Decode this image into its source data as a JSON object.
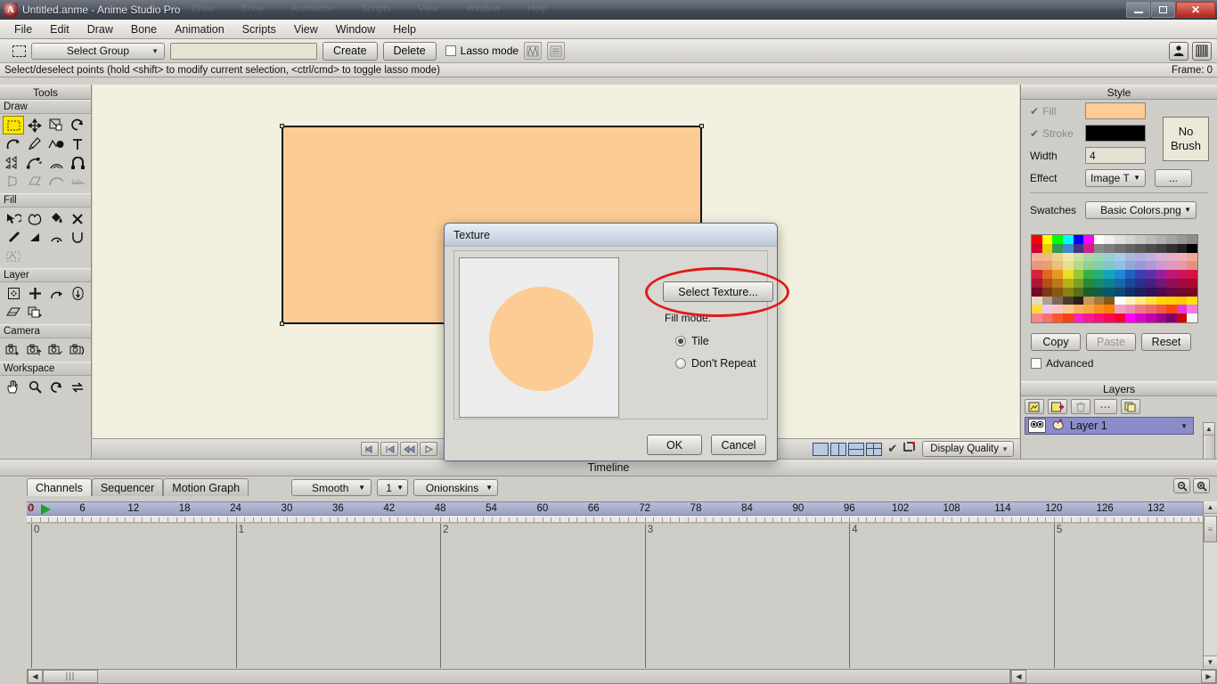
{
  "window": {
    "title": "Untitled.anme - Anime Studio Pro",
    "app_icon": "anime-studio-icon",
    "minimize": "minimize-icon",
    "restore": "restore-icon",
    "close": "close-icon",
    "ghost_menu": [
      "Draw",
      "Bone",
      "Animation",
      "Scripts",
      "View",
      "Window",
      "Help"
    ]
  },
  "menubar": {
    "items": [
      "File",
      "Edit",
      "Draw",
      "Bone",
      "Animation",
      "Scripts",
      "View",
      "Window",
      "Help"
    ]
  },
  "toolbar": {
    "marquee_icon": "marquee-select-icon",
    "group_dropdown": "Select Group",
    "name_field_value": "",
    "create_label": "Create",
    "delete_label": "Delete",
    "lasso_label": "Lasso mode",
    "lasso_checked": false,
    "icon1": "symmetry-icon",
    "icon2": "point-list-icon",
    "right_icon1": "character-icon",
    "right_icon2": "library-icon"
  },
  "statusline": {
    "hint": "Select/deselect points (hold <shift> to modify current selection, <ctrl/cmd> to toggle lasso mode)",
    "frame": "Frame: 0"
  },
  "tools_panel": {
    "title": "Tools",
    "sections": [
      {
        "name": "Draw",
        "tools": [
          {
            "name": "select-points-tool",
            "icon": "marquee-icon",
            "selected": true,
            "dim": false
          },
          {
            "name": "transform-points-tool",
            "icon": "move-arrows-icon",
            "selected": false,
            "dim": false
          },
          {
            "name": "scale-points-tool",
            "icon": "scale-icon",
            "selected": false,
            "dim": false
          },
          {
            "name": "rotate-points-tool",
            "icon": "rotate-icon",
            "selected": false,
            "dim": false
          },
          {
            "name": "curvature-tool",
            "icon": "curve-icon",
            "selected": false,
            "dim": false
          },
          {
            "name": "add-point-tool",
            "icon": "pen-icon",
            "selected": false,
            "dim": false
          },
          {
            "name": "draw-shape-tool",
            "icon": "shape-icon",
            "selected": false,
            "dim": false
          },
          {
            "name": "text-tool",
            "icon": "text-icon",
            "selected": false,
            "dim": false
          },
          {
            "name": "magnet-tool",
            "icon": "triangles-icon",
            "selected": false,
            "dim": false
          },
          {
            "name": "perspective-points-tool",
            "icon": "perspective-icon",
            "selected": false,
            "dim": false
          },
          {
            "name": "bend-points-tool",
            "icon": "bend-icon",
            "selected": false,
            "dim": false
          },
          {
            "name": "noise-tool",
            "icon": "magnet-icon",
            "selected": false,
            "dim": false
          },
          {
            "name": "shear-points-tool",
            "icon": "shear-icon",
            "selected": false,
            "dim": true
          },
          {
            "name": "weld-points-tool",
            "icon": "weld-icon",
            "selected": false,
            "dim": true
          },
          {
            "name": "smooth-tool",
            "icon": "smooth-arc-icon",
            "selected": false,
            "dim": true
          },
          {
            "name": "hatch-tool",
            "icon": "hatch-icon",
            "selected": false,
            "dim": true
          }
        ]
      },
      {
        "name": "Fill",
        "tools": [
          {
            "name": "select-shape-tool",
            "icon": "cursor-shape-icon",
            "selected": false,
            "dim": false
          },
          {
            "name": "create-shape-tool",
            "icon": "blob-icon",
            "selected": false,
            "dim": false
          },
          {
            "name": "paint-bucket-tool",
            "icon": "paint-bucket-icon",
            "selected": false,
            "dim": false
          },
          {
            "name": "delete-shape-tool",
            "icon": "x-icon",
            "selected": false,
            "dim": false
          },
          {
            "name": "eyedropper-tool",
            "icon": "eyedropper-icon",
            "selected": false,
            "dim": false
          },
          {
            "name": "gradient-tool",
            "icon": "gradient-triangle-icon",
            "selected": false,
            "dim": false
          },
          {
            "name": "line-width-tool",
            "icon": "line-width-icon",
            "selected": false,
            "dim": false
          },
          {
            "name": "hide-edge-tool",
            "icon": "hide-edge-icon",
            "selected": false,
            "dim": false
          },
          {
            "name": "stroke-exposure-tool",
            "icon": "stroke-exposure-icon",
            "selected": false,
            "dim": true
          }
        ]
      },
      {
        "name": "Layer",
        "tools": [
          {
            "name": "transform-layer-tool",
            "icon": "transform-layer-icon",
            "selected": false,
            "dim": false
          },
          {
            "name": "translate-layer-tool",
            "icon": "plus-move-icon",
            "selected": false,
            "dim": false
          },
          {
            "name": "rotate-layer-z-tool",
            "icon": "rotate-z-icon",
            "selected": false,
            "dim": false
          },
          {
            "name": "rotate-layer-xy-tool",
            "icon": "rotate-xy-icon",
            "selected": false,
            "dim": false
          },
          {
            "name": "shear-layer-tool",
            "icon": "shear-layer-icon",
            "selected": false,
            "dim": false
          },
          {
            "name": "set-origin-tool",
            "icon": "layer-order-icon",
            "selected": false,
            "dim": false
          }
        ]
      },
      {
        "name": "Camera",
        "tools": [
          {
            "name": "track-camera-tool",
            "icon": "camera-track-icon",
            "selected": false,
            "dim": false
          },
          {
            "name": "zoom-camera-tool",
            "icon": "camera-zoom-icon",
            "selected": false,
            "dim": false
          },
          {
            "name": "roll-camera-tool",
            "icon": "camera-roll-icon",
            "selected": false,
            "dim": false
          },
          {
            "name": "pan-tilt-camera-tool",
            "icon": "camera-pan-icon",
            "selected": false,
            "dim": false
          }
        ]
      },
      {
        "name": "Workspace",
        "tools": [
          {
            "name": "pan-workspace-tool",
            "icon": "hand-icon",
            "selected": false,
            "dim": false
          },
          {
            "name": "zoom-workspace-tool",
            "icon": "magnifier-icon",
            "selected": false,
            "dim": false
          },
          {
            "name": "rotate-workspace-tool",
            "icon": "rotate-workspace-icon",
            "selected": false,
            "dim": false
          },
          {
            "name": "reset-workspace-tool",
            "icon": "reset-workspace-icon",
            "selected": false,
            "dim": false
          }
        ]
      }
    ]
  },
  "canvas": {
    "shape_fill": "#fdcb94",
    "shape_stroke": "#111111",
    "background": "#f2f1df",
    "playback": [
      {
        "name": "rewind-to-start-button",
        "icon": "skip-start-icon"
      },
      {
        "name": "step-back-keyframe-button",
        "icon": "prev-key-icon"
      },
      {
        "name": "step-back-frame-button",
        "icon": "prev-frame-icon"
      },
      {
        "name": "play-button",
        "icon": "play-icon"
      }
    ],
    "view_modes": [
      "single-view",
      "two-column-view",
      "two-row-view",
      "quad-view"
    ],
    "show_edges_checked": true,
    "crop_icon": "crop-icon",
    "display_quality": "Display Quality"
  },
  "style_panel": {
    "title": "Style",
    "fill_label": "Fill",
    "fill_checked": true,
    "fill_color": "#fdcb94",
    "stroke_label": "Stroke",
    "stroke_checked": true,
    "stroke_color": "#000000",
    "no_brush_line1": "No",
    "no_brush_line2": "Brush",
    "width_label": "Width",
    "width_value": "4",
    "effect_label": "Effect",
    "effect_value": "Image T",
    "effect_more": "...",
    "swatches_label": "Swatches",
    "swatches_value": "Basic Colors.png",
    "copy_label": "Copy",
    "paste_label": "Paste",
    "paste_disabled": true,
    "reset_label": "Reset",
    "advanced_label": "Advanced",
    "advanced_checked": false,
    "swatch_rows": [
      [
        "#ff0000",
        "#ffff00",
        "#00ff00",
        "#00ffff",
        "#0000ff",
        "#ff00ff",
        "#ffffff",
        "#f0f0f0",
        "#e0e0e0",
        "#d4d4d4",
        "#c8c8c8",
        "#bcbcbc",
        "#b0b0b0",
        "#a4a4a4",
        "#989898",
        "#8c8c8c"
      ],
      [
        "#cc0033",
        "#e8d000",
        "#339955",
        "#4488cc",
        "#443388",
        "#cc2288",
        "#888888",
        "#7c7c7c",
        "#707070",
        "#646464",
        "#585858",
        "#4c4c4c",
        "#404040",
        "#303030",
        "#202020",
        "#000000"
      ],
      [
        "#f0b098",
        "#f0b888",
        "#f0d090",
        "#f0e8a8",
        "#c8e0a0",
        "#a8d8a8",
        "#98d8b8",
        "#98d0d0",
        "#a8cde8",
        "#a8b8e0",
        "#b0b0e0",
        "#c0b0e0",
        "#d8b0d8",
        "#e8b0c8",
        "#f0b0b8",
        "#f0a898"
      ],
      [
        "#e89880",
        "#e8a070",
        "#e8c078",
        "#e8e090",
        "#b8d888",
        "#90d090",
        "#80d0a8",
        "#80c8c8",
        "#90c0e8",
        "#90a8d8",
        "#9898d8",
        "#b098d8",
        "#d098d0",
        "#e098c0",
        "#e898a8",
        "#e89080"
      ],
      [
        "#d82040",
        "#e06820",
        "#e89820",
        "#e8e020",
        "#98c830",
        "#38b048",
        "#20b080",
        "#10a8b8",
        "#2088d8",
        "#2060c0",
        "#3840b0",
        "#6030a8",
        "#9820a0",
        "#c01878",
        "#d01058",
        "#d81040"
      ],
      [
        "#a81838",
        "#b05018",
        "#b87818",
        "#b8b018",
        "#78a028",
        "#288838",
        "#188868",
        "#108090",
        "#1868a8",
        "#184898",
        "#283088",
        "#482080",
        "#701878",
        "#901058",
        "#a00840",
        "#a80830"
      ],
      [
        "#780828",
        "#803810",
        "#885810",
        "#888010",
        "#587018",
        "#186028",
        "#106048",
        "#085868",
        "#104878",
        "#103068",
        "#182060",
        "#301058",
        "#500850",
        "#680840",
        "#700830",
        "#780820"
      ],
      [
        "#e8dcc0",
        "#b0a090",
        "#7a6a58",
        "#4a3c30",
        "#2a2018",
        "#c89858",
        "#a87838",
        "#885818",
        "#ffffff",
        "#fff0c0",
        "#ffe880",
        "#ffe040",
        "#ffd800",
        "#ffd000",
        "#ffc800",
        "#ffe000"
      ],
      [
        "#ffd840",
        "#f0c8e8",
        "#f8c8c0",
        "#f8c890",
        "#f8b060",
        "#f8a840",
        "#f89020",
        "#f88000",
        "#f0a0c0",
        "#f090b0",
        "#f07888",
        "#f06870",
        "#f05850",
        "#f84810",
        "#e838d8",
        "#f078e8"
      ],
      [
        "#f88890",
        "#f87070",
        "#f85830",
        "#f84010",
        "#f820c0",
        "#f81898",
        "#f81078",
        "#f80858",
        "#f80030",
        "#ff00ff",
        "#e000d0",
        "#c000b0",
        "#a00090",
        "#800070",
        "#d00000",
        "#f8f8f8"
      ]
    ]
  },
  "layers_panel": {
    "title": "Layers",
    "toolbar": [
      {
        "name": "new-layer-button",
        "icon": "new-layer-icon"
      },
      {
        "name": "add-layer-button",
        "icon": "add-layer-icon"
      },
      {
        "name": "delete-layer-button",
        "icon": "trash-icon"
      },
      {
        "name": "layer-options-button",
        "icon": "ellipsis-icon"
      },
      {
        "name": "duplicate-layer-button",
        "icon": "duplicate-layer-icon"
      }
    ],
    "rows": [
      {
        "name": "Layer 1",
        "visible_icon": "eyes-icon",
        "type_icon": "vector-layer-icon",
        "selected": true
      }
    ]
  },
  "timeline": {
    "title": "Timeline",
    "tabs": [
      {
        "label": "Channels",
        "active": true
      },
      {
        "label": "Sequencer",
        "active": false
      },
      {
        "label": "Motion Graph",
        "active": false
      }
    ],
    "interpolation": "Smooth",
    "onionskin_count": "1",
    "onionskins_label": "Onionskins",
    "zoom_out_icon": "zoom-out-icon",
    "zoom_in_icon": "zoom-in-icon",
    "ruler_ticks": [
      0,
      6,
      12,
      18,
      24,
      30,
      36,
      42,
      48,
      54,
      60,
      66,
      72,
      78,
      84,
      90,
      96,
      102,
      108,
      114,
      120,
      126,
      132
    ],
    "second_markers": [
      "0",
      "1",
      "2",
      "3",
      "4",
      "5"
    ],
    "playhead_frame": 0,
    "playhead_icon": "playhead-marker-icon",
    "play_marker_icon": "green-play-triangle-icon"
  },
  "dialog": {
    "title": "Texture",
    "preview_name": "texture-preview",
    "preview_circle_color": "#fdcb94",
    "select_texture_label": "Select Texture...",
    "fill_mode_label": "Fill mode:",
    "radios": [
      {
        "label": "Tile",
        "selected": true
      },
      {
        "label": "Don't Repeat",
        "selected": false
      }
    ],
    "ok_label": "OK",
    "cancel_label": "Cancel",
    "annotation": {
      "shape": "ellipse",
      "color": "#e01b1b"
    }
  }
}
